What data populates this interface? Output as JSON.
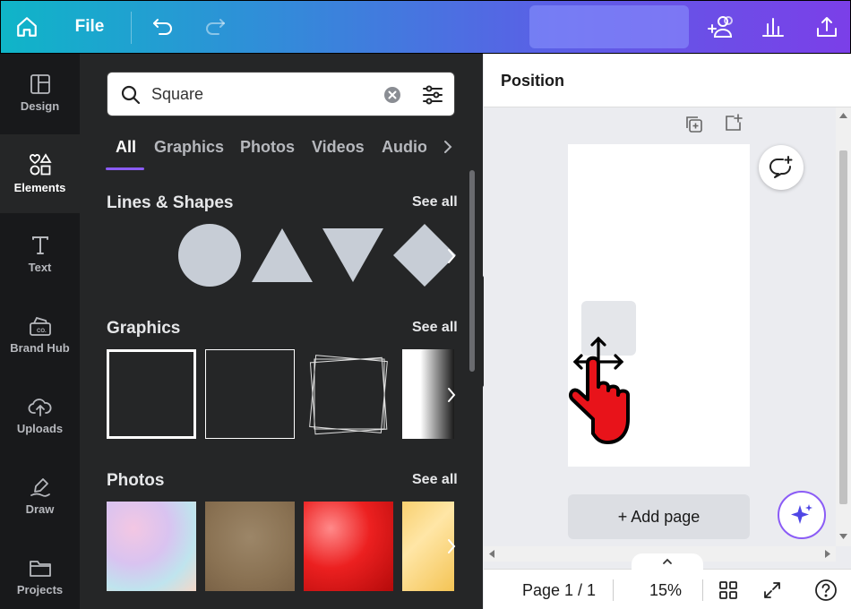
{
  "topbar": {
    "file_label": "File",
    "icons": [
      "home-icon",
      "undo-icon",
      "redo-icon",
      "share-people-icon",
      "insights-icon",
      "upload-icon"
    ]
  },
  "rail": {
    "items": [
      {
        "label": "Design",
        "icon": "layout-icon"
      },
      {
        "label": "Elements",
        "icon": "elements-icon"
      },
      {
        "label": "Text",
        "icon": "text-icon"
      },
      {
        "label": "Brand Hub",
        "icon": "brand-hub-icon"
      },
      {
        "label": "Uploads",
        "icon": "cloud-upload-icon"
      },
      {
        "label": "Draw",
        "icon": "draw-icon"
      },
      {
        "label": "Projects",
        "icon": "folder-icon"
      }
    ]
  },
  "panel": {
    "search_value": "Square",
    "tabs": [
      "All",
      "Graphics",
      "Photos",
      "Videos",
      "Audio"
    ],
    "sections": {
      "lines_shapes": {
        "title": "Lines & Shapes",
        "see_all": "See all"
      },
      "graphics": {
        "title": "Graphics",
        "see_all": "See all"
      },
      "photos": {
        "title": "Photos",
        "see_all": "See all"
      }
    }
  },
  "right": {
    "header_title": "Position",
    "add_page": "+ Add page",
    "footer": {
      "page": "Page 1 / 1",
      "zoom": "15%"
    }
  },
  "colors": {
    "accent": "#8b5cf6",
    "panel": "#252627",
    "rail": "#18191b"
  }
}
